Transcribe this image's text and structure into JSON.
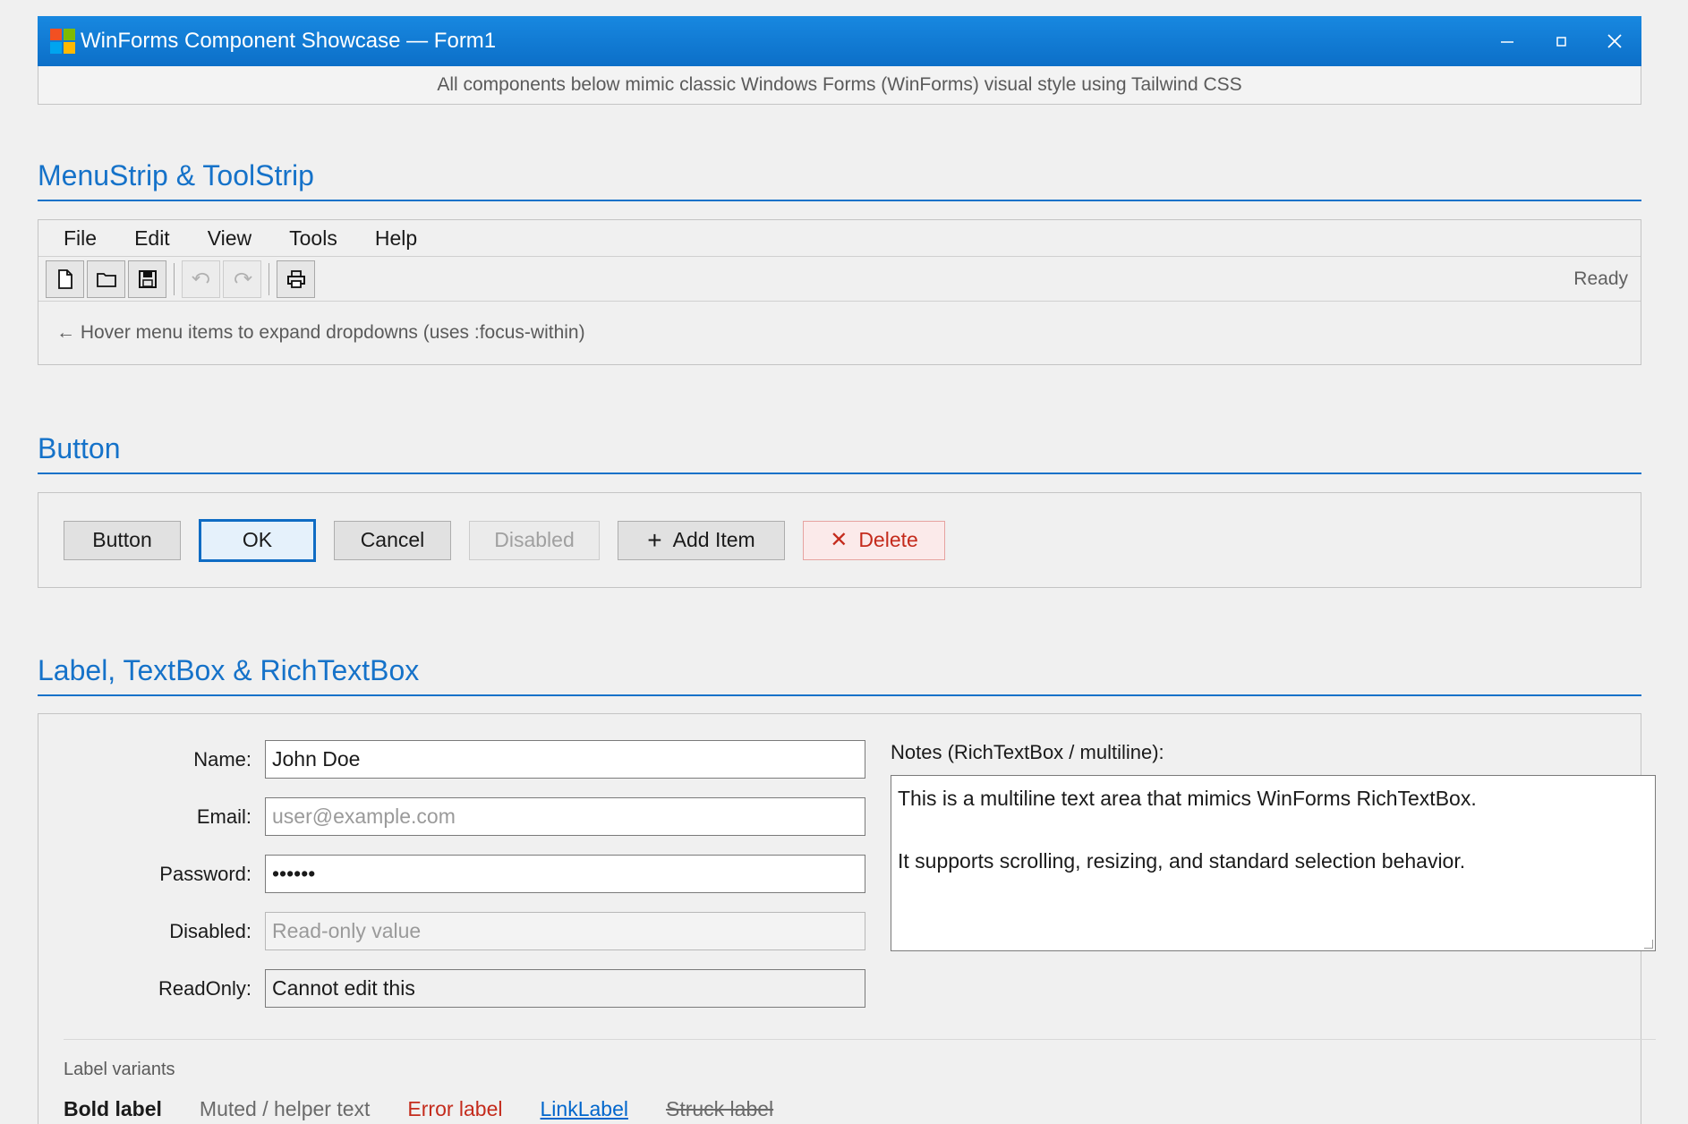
{
  "window": {
    "title": "WinForms Component Showcase — Form1",
    "subtitle": "All components below mimic classic Windows Forms (WinForms) visual style using Tailwind CSS",
    "logo_colors": [
      "#f25022",
      "#7fba00",
      "#00a4ef",
      "#ffb900"
    ],
    "controls": {
      "minimize": "—",
      "maximize": "◻",
      "close": "✕"
    }
  },
  "menu_section": {
    "title": "MenuStrip & ToolStrip",
    "menu": [
      "File",
      "Edit",
      "View",
      "Tools",
      "Help"
    ],
    "toolbar": {
      "buttons": [
        {
          "icon": "new-document-icon",
          "enabled": true
        },
        {
          "icon": "open-folder-icon",
          "enabled": true
        },
        {
          "icon": "save-icon",
          "enabled": true
        },
        {
          "icon": "undo-icon",
          "enabled": false
        },
        {
          "icon": "redo-icon",
          "enabled": false
        },
        {
          "icon": "print-icon",
          "enabled": true
        }
      ],
      "status": "Ready"
    },
    "hint": "← Hover menu items to expand dropdowns (uses :focus-within)"
  },
  "button_section": {
    "title": "Button",
    "buttons": {
      "button": "Button",
      "ok": "OK",
      "cancel": "Cancel",
      "disabled": "Disabled",
      "add_item": "Add Item",
      "delete": "Delete"
    },
    "icons": {
      "add": "+",
      "delete": "✕"
    }
  },
  "text_section": {
    "title": "Label, TextBox & RichTextBox",
    "fields": {
      "name_label": "Name:",
      "name_value": "John Doe",
      "email_label": "Email:",
      "email_placeholder": "user@example.com",
      "password_label": "Password:",
      "password_value": "••••••",
      "disabled_label": "Disabled:",
      "disabled_value": "Read-only value",
      "readonly_label": "ReadOnly:",
      "readonly_value": "Cannot edit this"
    },
    "notes": {
      "label": "Notes (RichTextBox / multiline):",
      "line1": "This is a multiline text area that mimics WinForms RichTextBox.",
      "line2": "It supports scrolling, resizing, and standard selection behavior."
    },
    "label_variants": {
      "title": "Label variants",
      "bold": "Bold label",
      "muted": "Muted / helper text",
      "error": "Error label",
      "link": "LinkLabel",
      "struck": "Struck label"
    }
  },
  "colors": {
    "accent": "#1572c9",
    "error": "#c42b1c",
    "link": "#0066cc"
  }
}
